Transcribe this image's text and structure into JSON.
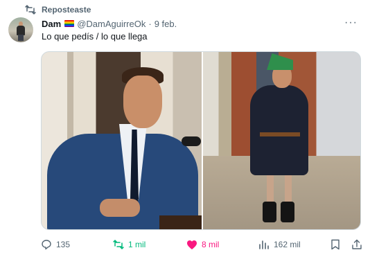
{
  "repost_label": "Reposteaste",
  "tweet": {
    "display_name": "Dam",
    "handle": "@DamAguirreOk",
    "separator": "·",
    "date": "9 feb.",
    "text": "Lo que pedís / lo que llega",
    "more": "···"
  },
  "actions": {
    "replies": "135",
    "reposts": "1 mil",
    "likes": "8 mil",
    "views": "162 mil"
  },
  "colors": {
    "secondary_text": "#536471",
    "repost_active": "#00ba7c",
    "like_active": "#f91880"
  },
  "icons": {
    "repost": "repost-icon",
    "more": "more-icon",
    "reply": "reply-icon",
    "like": "heart-icon",
    "views": "views-icon",
    "bookmark": "bookmark-icon",
    "share": "share-icon"
  }
}
